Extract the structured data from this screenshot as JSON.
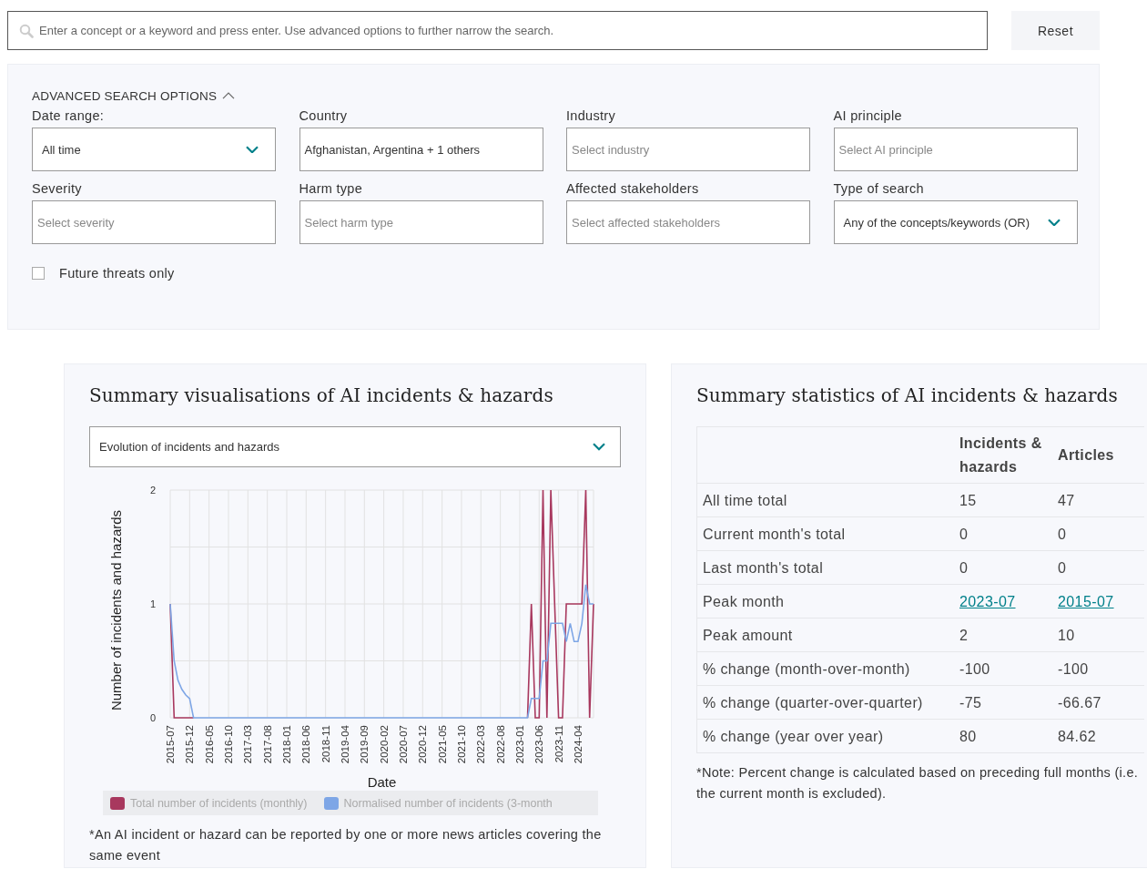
{
  "search": {
    "placeholder": "Enter a concept or a keyword and press enter. Use advanced options to further narrow the search."
  },
  "reset_button": "Reset",
  "advanced": {
    "title": "ADVANCED SEARCH OPTIONS",
    "expanded": true,
    "fields": [
      {
        "label": "Date range:",
        "kind": "select",
        "value": "All time"
      },
      {
        "label": "Country",
        "kind": "input",
        "value": "Afghanistan, Argentina + 1 others"
      },
      {
        "label": "Industry",
        "kind": "input",
        "placeholder": "Select industry"
      },
      {
        "label": "AI principle",
        "kind": "input",
        "placeholder": "Select AI principle"
      },
      {
        "label": "Severity",
        "kind": "input",
        "placeholder": "Select severity"
      },
      {
        "label": "Harm type",
        "kind": "input",
        "placeholder": "Select harm type"
      },
      {
        "label": "Affected stakeholders",
        "kind": "input",
        "placeholder": "Select affected stakeholders"
      },
      {
        "label": "Type of search",
        "kind": "select",
        "value": "Any of the concepts/keywords (OR)"
      }
    ],
    "future_threats": {
      "label": "Future threats only",
      "checked": false
    }
  },
  "visualisations": {
    "title": "Summary visualisations of AI incidents & hazards",
    "dropdown": {
      "value": "Evolution of incidents and hazards"
    },
    "chart_data": {
      "type": "line",
      "xlabel": "Date",
      "ylabel": "Number of incidents and hazards",
      "x": [
        "2015-07",
        "2015-08",
        "2015-09",
        "2015-10",
        "2015-11",
        "2015-12",
        "2016-01",
        "2016-02",
        "2016-03",
        "2016-04",
        "2016-05",
        "2016-06",
        "2016-07",
        "2016-08",
        "2016-09",
        "2016-10",
        "2016-11",
        "2016-12",
        "2017-01",
        "2017-02",
        "2017-03",
        "2017-04",
        "2017-05",
        "2017-06",
        "2017-07",
        "2017-08",
        "2017-09",
        "2017-10",
        "2017-11",
        "2017-12",
        "2018-01",
        "2018-02",
        "2018-03",
        "2018-04",
        "2018-05",
        "2018-06",
        "2018-07",
        "2018-08",
        "2018-09",
        "2018-10",
        "2018-11",
        "2018-12",
        "2019-01",
        "2019-02",
        "2019-03",
        "2019-04",
        "2019-05",
        "2019-06",
        "2019-07",
        "2019-08",
        "2019-09",
        "2019-10",
        "2019-11",
        "2019-12",
        "2020-01",
        "2020-02",
        "2020-03",
        "2020-04",
        "2020-05",
        "2020-06",
        "2020-07",
        "2020-08",
        "2020-09",
        "2020-10",
        "2020-11",
        "2020-12",
        "2021-01",
        "2021-02",
        "2021-03",
        "2021-04",
        "2021-05",
        "2021-06",
        "2021-07",
        "2021-08",
        "2021-09",
        "2021-10",
        "2021-11",
        "2021-12",
        "2022-01",
        "2022-02",
        "2022-03",
        "2022-04",
        "2022-05",
        "2022-06",
        "2022-07",
        "2022-08",
        "2022-09",
        "2022-10",
        "2022-11",
        "2022-12",
        "2023-01",
        "2023-02",
        "2023-03",
        "2023-04",
        "2023-05",
        "2023-06",
        "2023-07",
        "2023-08",
        "2023-09",
        "2023-10",
        "2023-11",
        "2023-12",
        "2024-01",
        "2024-02",
        "2024-03",
        "2024-04",
        "2024-05",
        "2024-06",
        "2024-07",
        "2024-08"
      ],
      "series": [
        {
          "name": "Total number of incidents (monthly)",
          "color": "#a8385e",
          "values": [
            1,
            0,
            0,
            0,
            0,
            0,
            0,
            null,
            null,
            null,
            null,
            null,
            null,
            null,
            null,
            null,
            null,
            null,
            null,
            null,
            null,
            null,
            null,
            null,
            null,
            null,
            null,
            null,
            null,
            null,
            null,
            null,
            null,
            null,
            null,
            null,
            null,
            null,
            null,
            null,
            null,
            null,
            null,
            null,
            null,
            null,
            null,
            null,
            null,
            null,
            null,
            null,
            null,
            null,
            null,
            null,
            null,
            null,
            null,
            null,
            null,
            null,
            null,
            null,
            null,
            null,
            null,
            null,
            null,
            null,
            null,
            null,
            null,
            null,
            null,
            null,
            null,
            null,
            null,
            null,
            null,
            null,
            null,
            null,
            null,
            null,
            null,
            null,
            null,
            null,
            null,
            null,
            0,
            1,
            0,
            0,
            2,
            0,
            2,
            1,
            0,
            0,
            1,
            1,
            1,
            1,
            1,
            2,
            0,
            1
          ]
        },
        {
          "name": "Normalised number of incidents (3-month",
          "color": "#7ea6e6",
          "values": [
            1,
            0.5,
            0.33,
            0.25,
            0.2,
            0.17,
            0,
            0,
            0,
            0,
            0,
            0,
            0,
            0,
            0,
            0,
            0,
            0,
            0,
            0,
            0,
            0,
            0,
            0,
            0,
            0,
            0,
            0,
            0,
            0,
            0,
            0,
            0,
            0,
            0,
            0,
            0,
            0,
            0,
            0,
            0,
            0,
            0,
            0,
            0,
            0,
            0,
            0,
            0,
            0,
            0,
            0,
            0,
            0,
            0,
            0,
            0,
            0,
            0,
            0,
            0,
            0,
            0,
            0,
            0,
            0,
            0,
            0,
            0,
            0,
            0,
            0,
            0,
            0,
            0,
            0,
            0,
            0,
            0,
            0,
            0,
            0,
            0,
            0,
            0,
            0,
            0,
            0,
            0,
            0,
            0,
            0,
            0,
            0.17,
            0.17,
            0.17,
            0.5,
            0.5,
            0.83,
            0.83,
            0.83,
            0.83,
            0.67,
            0.83,
            0.67,
            0.67,
            0.83,
            1.17,
            1,
            1
          ]
        }
      ],
      "xlim": [
        "2015-07",
        "2024-08"
      ],
      "ylim": [
        0,
        2
      ],
      "grid": true,
      "yticks": [
        0,
        1,
        2
      ],
      "xticks": [
        "2015-07",
        "2015-12",
        "2016-05",
        "2016-10",
        "2017-03",
        "2017-08",
        "2018-01",
        "2018-06",
        "2018-11",
        "2019-04",
        "2019-09",
        "2020-02",
        "2020-07",
        "2020-12",
        "2021-05",
        "2021-10",
        "2022-03",
        "2022-08",
        "2023-01",
        "2023-06",
        "2023-11",
        "2024-04"
      ]
    },
    "note": "*An AI incident or hazard can be reported by one or more news articles covering the same event"
  },
  "statistics": {
    "title": "Summary statistics of AI incidents & hazards",
    "columns": [
      "Incidents & hazards",
      "Articles"
    ],
    "rows": [
      {
        "label": "All time total",
        "cells": [
          {
            "text": "15",
            "kind": "plain"
          },
          {
            "text": "47",
            "kind": "plain"
          }
        ]
      },
      {
        "label": "Current month's total",
        "cells": [
          {
            "text": "0",
            "kind": "plain"
          },
          {
            "text": "0",
            "kind": "plain"
          }
        ]
      },
      {
        "label": "Last month's total",
        "cells": [
          {
            "text": "0",
            "kind": "plain"
          },
          {
            "text": "0",
            "kind": "plain"
          }
        ]
      },
      {
        "label": "Peak month",
        "cells": [
          {
            "text": "2023-07",
            "kind": "link"
          },
          {
            "text": "2015-07",
            "kind": "link"
          }
        ]
      },
      {
        "label": "Peak amount",
        "cells": [
          {
            "text": "2",
            "kind": "plain"
          },
          {
            "text": "10",
            "kind": "plain"
          }
        ]
      },
      {
        "label": "% change (month-over-month)",
        "cells": [
          {
            "text": "-100",
            "kind": "plain"
          },
          {
            "text": "-100",
            "kind": "plain"
          }
        ]
      },
      {
        "label": "% change (quarter-over-quarter)",
        "cells": [
          {
            "text": "-75",
            "kind": "plain"
          },
          {
            "text": "-66.67",
            "kind": "plain"
          }
        ]
      },
      {
        "label": "% change (year over year)",
        "cells": [
          {
            "text": "80",
            "kind": "plain"
          },
          {
            "text": "84.62",
            "kind": "plain"
          }
        ]
      }
    ],
    "note": "*Note: Percent change is calculated based on preceding full months (i.e. the current month is excluded)."
  }
}
